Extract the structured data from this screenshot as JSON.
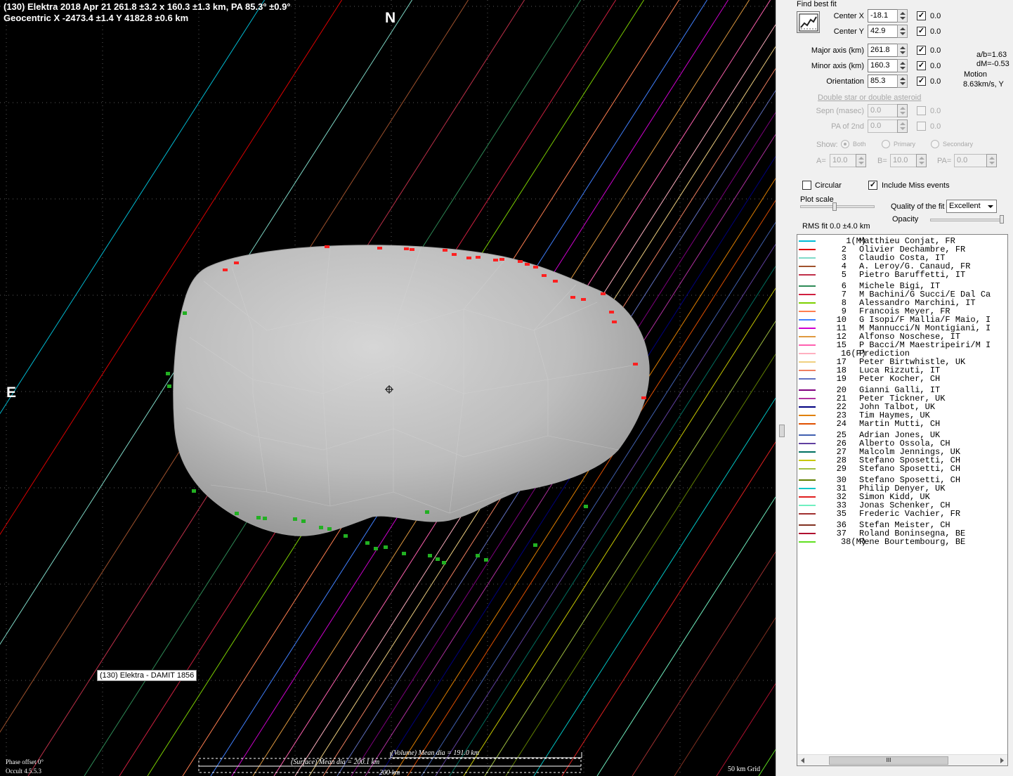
{
  "plot": {
    "header_line1": "(130) Elektra  2018 Apr 21   261.8 ±3.2 x 160.3 ±1.3 km, PA 85.3° ±0.9°",
    "header_line2": "Geocentric  X  -2473.4 ±1.4   Y 4182.8 ±0.6 km",
    "north_label": "N",
    "east_label": "E",
    "model_label": "(130) Elektra - DAMIT 1856",
    "phase_offset": "Phase offset 0°",
    "version": "Occult 4.5.5.3",
    "grid_label": "50 km Grid",
    "volume_dia": "(Volume) Mean dia = 191.0 km",
    "surface_dia": "(Surface) Mean dia = 200.1 km",
    "scale_label": "200 km",
    "colors": {
      "background": "#000000",
      "asteroid": "#bfbfbf",
      "grid": "#5a5a5a",
      "disappear": "#ff2020",
      "reappear": "#22b022"
    }
  },
  "panel": {
    "find_best_fit": "Find best fit",
    "center_x": {
      "label": "Center X",
      "value": "-18.1",
      "checked": true,
      "uncert": "0.0"
    },
    "center_y": {
      "label": "Center Y",
      "value": "42.9",
      "checked": true,
      "uncert": "0.0"
    },
    "major_axis": {
      "label": "Major axis (km)",
      "value": "261.8",
      "checked": true,
      "uncert": "0.0"
    },
    "minor_axis": {
      "label": "Minor axis (km)",
      "value": "160.3",
      "checked": true,
      "uncert": "0.0"
    },
    "orientation": {
      "label": "Orientation",
      "value": "85.3",
      "checked": true,
      "uncert": "0.0"
    },
    "ab_ratio": "a/b=1.63",
    "dm": "dM=-0.53",
    "motion_label": "Motion",
    "motion_value": "8.63km/s, Y",
    "double_star": "Double star  or  double asteroid",
    "sepn": {
      "label": "Sepn (masec)",
      "value": "0.0",
      "uncert": "0.0"
    },
    "pa2nd": {
      "label": "PA of 2nd",
      "value": "0.0",
      "uncert": "0.0"
    },
    "show_label": "Show:",
    "show_both": "Both",
    "show_primary": "Primary",
    "show_secondary": "Secondary",
    "a_label": "A=",
    "a_value": "10.0",
    "b_label": "B=",
    "b_value": "10.0",
    "pa_label": "PA=",
    "pa_value": "0.0",
    "circular": "Circular",
    "include_miss": "Include Miss events",
    "plot_scale": "Plot scale",
    "quality_label": "Quality of the fit",
    "quality_value": "Excellent",
    "opacity": "Opacity",
    "rms_fit": "RMS fit  0.0 ±4.0 km",
    "hscroll_grip": "III"
  },
  "observers": [
    {
      "num": "1",
      "flag": "(M)",
      "name": "Matthieu Conjat, FR",
      "color": "#00bcd4"
    },
    {
      "num": "2",
      "flag": "",
      "name": "Olivier Dechambre, FR",
      "color": "#e00000"
    },
    {
      "num": "3",
      "flag": "",
      "name": "Claudio Costa, IT",
      "color": "#7fdac8"
    },
    {
      "num": "4",
      "flag": "",
      "name": "A. Leroy/G. Canaud, FR",
      "color": "#a0522d"
    },
    {
      "num": "5",
      "flag": "",
      "name": "Pietro Baruffetti, IT",
      "color": "#c0304a"
    },
    {
      "num": "6",
      "flag": "",
      "name": "Michele Bigi, IT",
      "color": "#2e8b57"
    },
    {
      "num": "7",
      "flag": "",
      "name": "M Bachini/G Succi/E Dal Ca",
      "color": "#d02040"
    },
    {
      "num": "8",
      "flag": "",
      "name": "Alessandro Marchini, IT",
      "color": "#7cd000"
    },
    {
      "num": "9",
      "flag": "",
      "name": "Francois Meyer, FR",
      "color": "#ff7f50"
    },
    {
      "num": "10",
      "flag": "",
      "name": "G Isopi/F Mallia/F Maio, I",
      "color": "#4080ff"
    },
    {
      "num": "11",
      "flag": "",
      "name": "M Mannucci/N Montigiani, I",
      "color": "#d000d0"
    },
    {
      "num": "12",
      "flag": "",
      "name": "Alfonso Noschese, IT",
      "color": "#e09a40"
    },
    {
      "num": "15",
      "flag": "",
      "name": "P Bacci/M Maestripeiri/M I",
      "color": "#ff60b0"
    },
    {
      "num": "16",
      "flag": "(P)",
      "name": "Prediction",
      "color": "#ffb0c0"
    },
    {
      "num": "17",
      "flag": "",
      "name": "Peter Birtwhistle, UK",
      "color": "#f0d080"
    },
    {
      "num": "18",
      "flag": "",
      "name": "Luca Rizzuti, IT",
      "color": "#f08060"
    },
    {
      "num": "19",
      "flag": "",
      "name": "Peter Kocher, CH",
      "color": "#6070c0"
    },
    {
      "num": "20",
      "flag": "",
      "name": "Gianni Galli, IT",
      "color": "#800080"
    },
    {
      "num": "21",
      "flag": "",
      "name": "Peter Tickner, UK",
      "color": "#b030a0"
    },
    {
      "num": "22",
      "flag": "",
      "name": "John Talbot, UK",
      "color": "#000080"
    },
    {
      "num": "23",
      "flag": "",
      "name": "Tim Haymes, UK",
      "color": "#e08000"
    },
    {
      "num": "24",
      "flag": "",
      "name": "Martin Mutti, CH",
      "color": "#e05000"
    },
    {
      "num": "25",
      "flag": "",
      "name": "Adrian Jones, UK",
      "color": "#4060b0"
    },
    {
      "num": "26",
      "flag": "",
      "name": "Alberto Ossola, CH",
      "color": "#6040a0"
    },
    {
      "num": "27",
      "flag": "",
      "name": "Malcolm Jennings, UK",
      "color": "#007060"
    },
    {
      "num": "28",
      "flag": "",
      "name": "Stefano Sposetti, CH",
      "color": "#c8c800"
    },
    {
      "num": "29",
      "flag": "",
      "name": "Stefano Sposetti, CH",
      "color": "#a0c040"
    },
    {
      "num": "30",
      "flag": "",
      "name": "Stefano Sposetti, CH",
      "color": "#608000"
    },
    {
      "num": "31",
      "flag": "",
      "name": "Philip Denyer, UK",
      "color": "#00c8c8"
    },
    {
      "num": "32",
      "flag": "",
      "name": "Simon Kidd, UK",
      "color": "#e02020"
    },
    {
      "num": "33",
      "flag": "",
      "name": "Jonas Schenker, CH",
      "color": "#70f0c0"
    },
    {
      "num": "35",
      "flag": "",
      "name": "Frederic Vachier, FR",
      "color": "#a03030"
    },
    {
      "num": "36",
      "flag": "",
      "name": "Stefan Meister, CH",
      "color": "#803020"
    },
    {
      "num": "37",
      "flag": "",
      "name": "Roland Boninsegna, BE",
      "color": "#b01030"
    },
    {
      "num": "38",
      "flag": "(M)",
      "name": "Rene Bourtembourg, BE",
      "color": "#60e020"
    }
  ]
}
